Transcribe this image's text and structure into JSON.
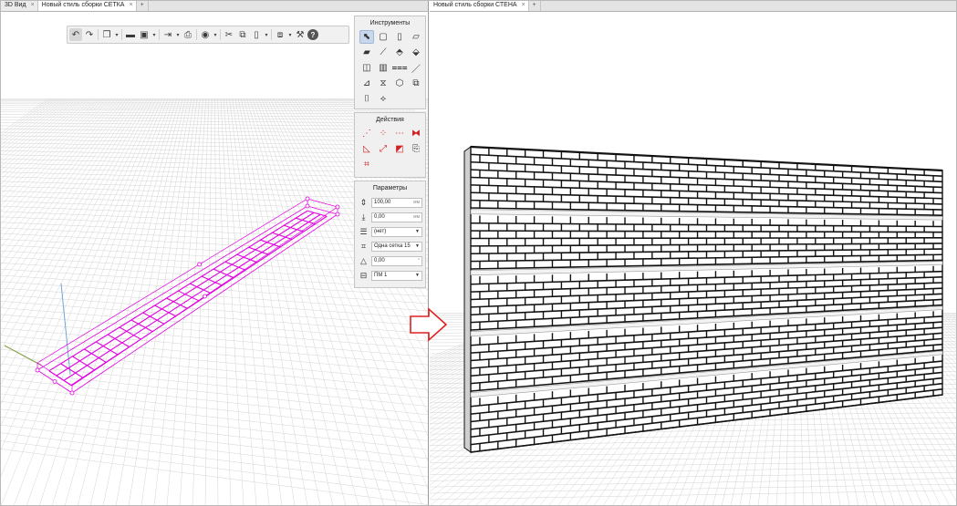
{
  "left_pane": {
    "tabs": [
      {
        "label": "3D Вид"
      },
      {
        "label": "Новый стиль сборки СЕТКА"
      }
    ],
    "close_glyph": "×",
    "add_tab_glyph": "+"
  },
  "right_pane": {
    "tabs": [
      {
        "label": "Новый стиль сборки СТЕНА"
      }
    ],
    "close_glyph": "×",
    "add_tab_glyph": "+"
  },
  "toolbar": {
    "icons": [
      "undo-icon",
      "redo-icon",
      "copy-view-icon",
      "folder-icon",
      "save-icon",
      "export-icon",
      "print-icon",
      "render-icon",
      "cut-icon",
      "copy-icon",
      "paste-icon",
      "layers-icon",
      "settings-icon",
      "help-icon"
    ],
    "help_glyph": "?"
  },
  "tools_panel": {
    "title": "Инструменты"
  },
  "actions_panel": {
    "title": "Действия"
  },
  "params_panel": {
    "title": "Параметры",
    "fields": [
      {
        "value": "100,00",
        "unit": "мм"
      },
      {
        "value": "0,00",
        "unit": "мм"
      },
      {
        "value": "(нет)"
      },
      {
        "value": "Одна сетка 15"
      },
      {
        "value": "0,00",
        "unit": "°"
      },
      {
        "value": "ПМ 1"
      }
    ]
  },
  "colors": {
    "mesh": "#e000e0",
    "arrow": "#e02020",
    "grid": "#d4d4d4",
    "selected": "#c8d7ea"
  }
}
